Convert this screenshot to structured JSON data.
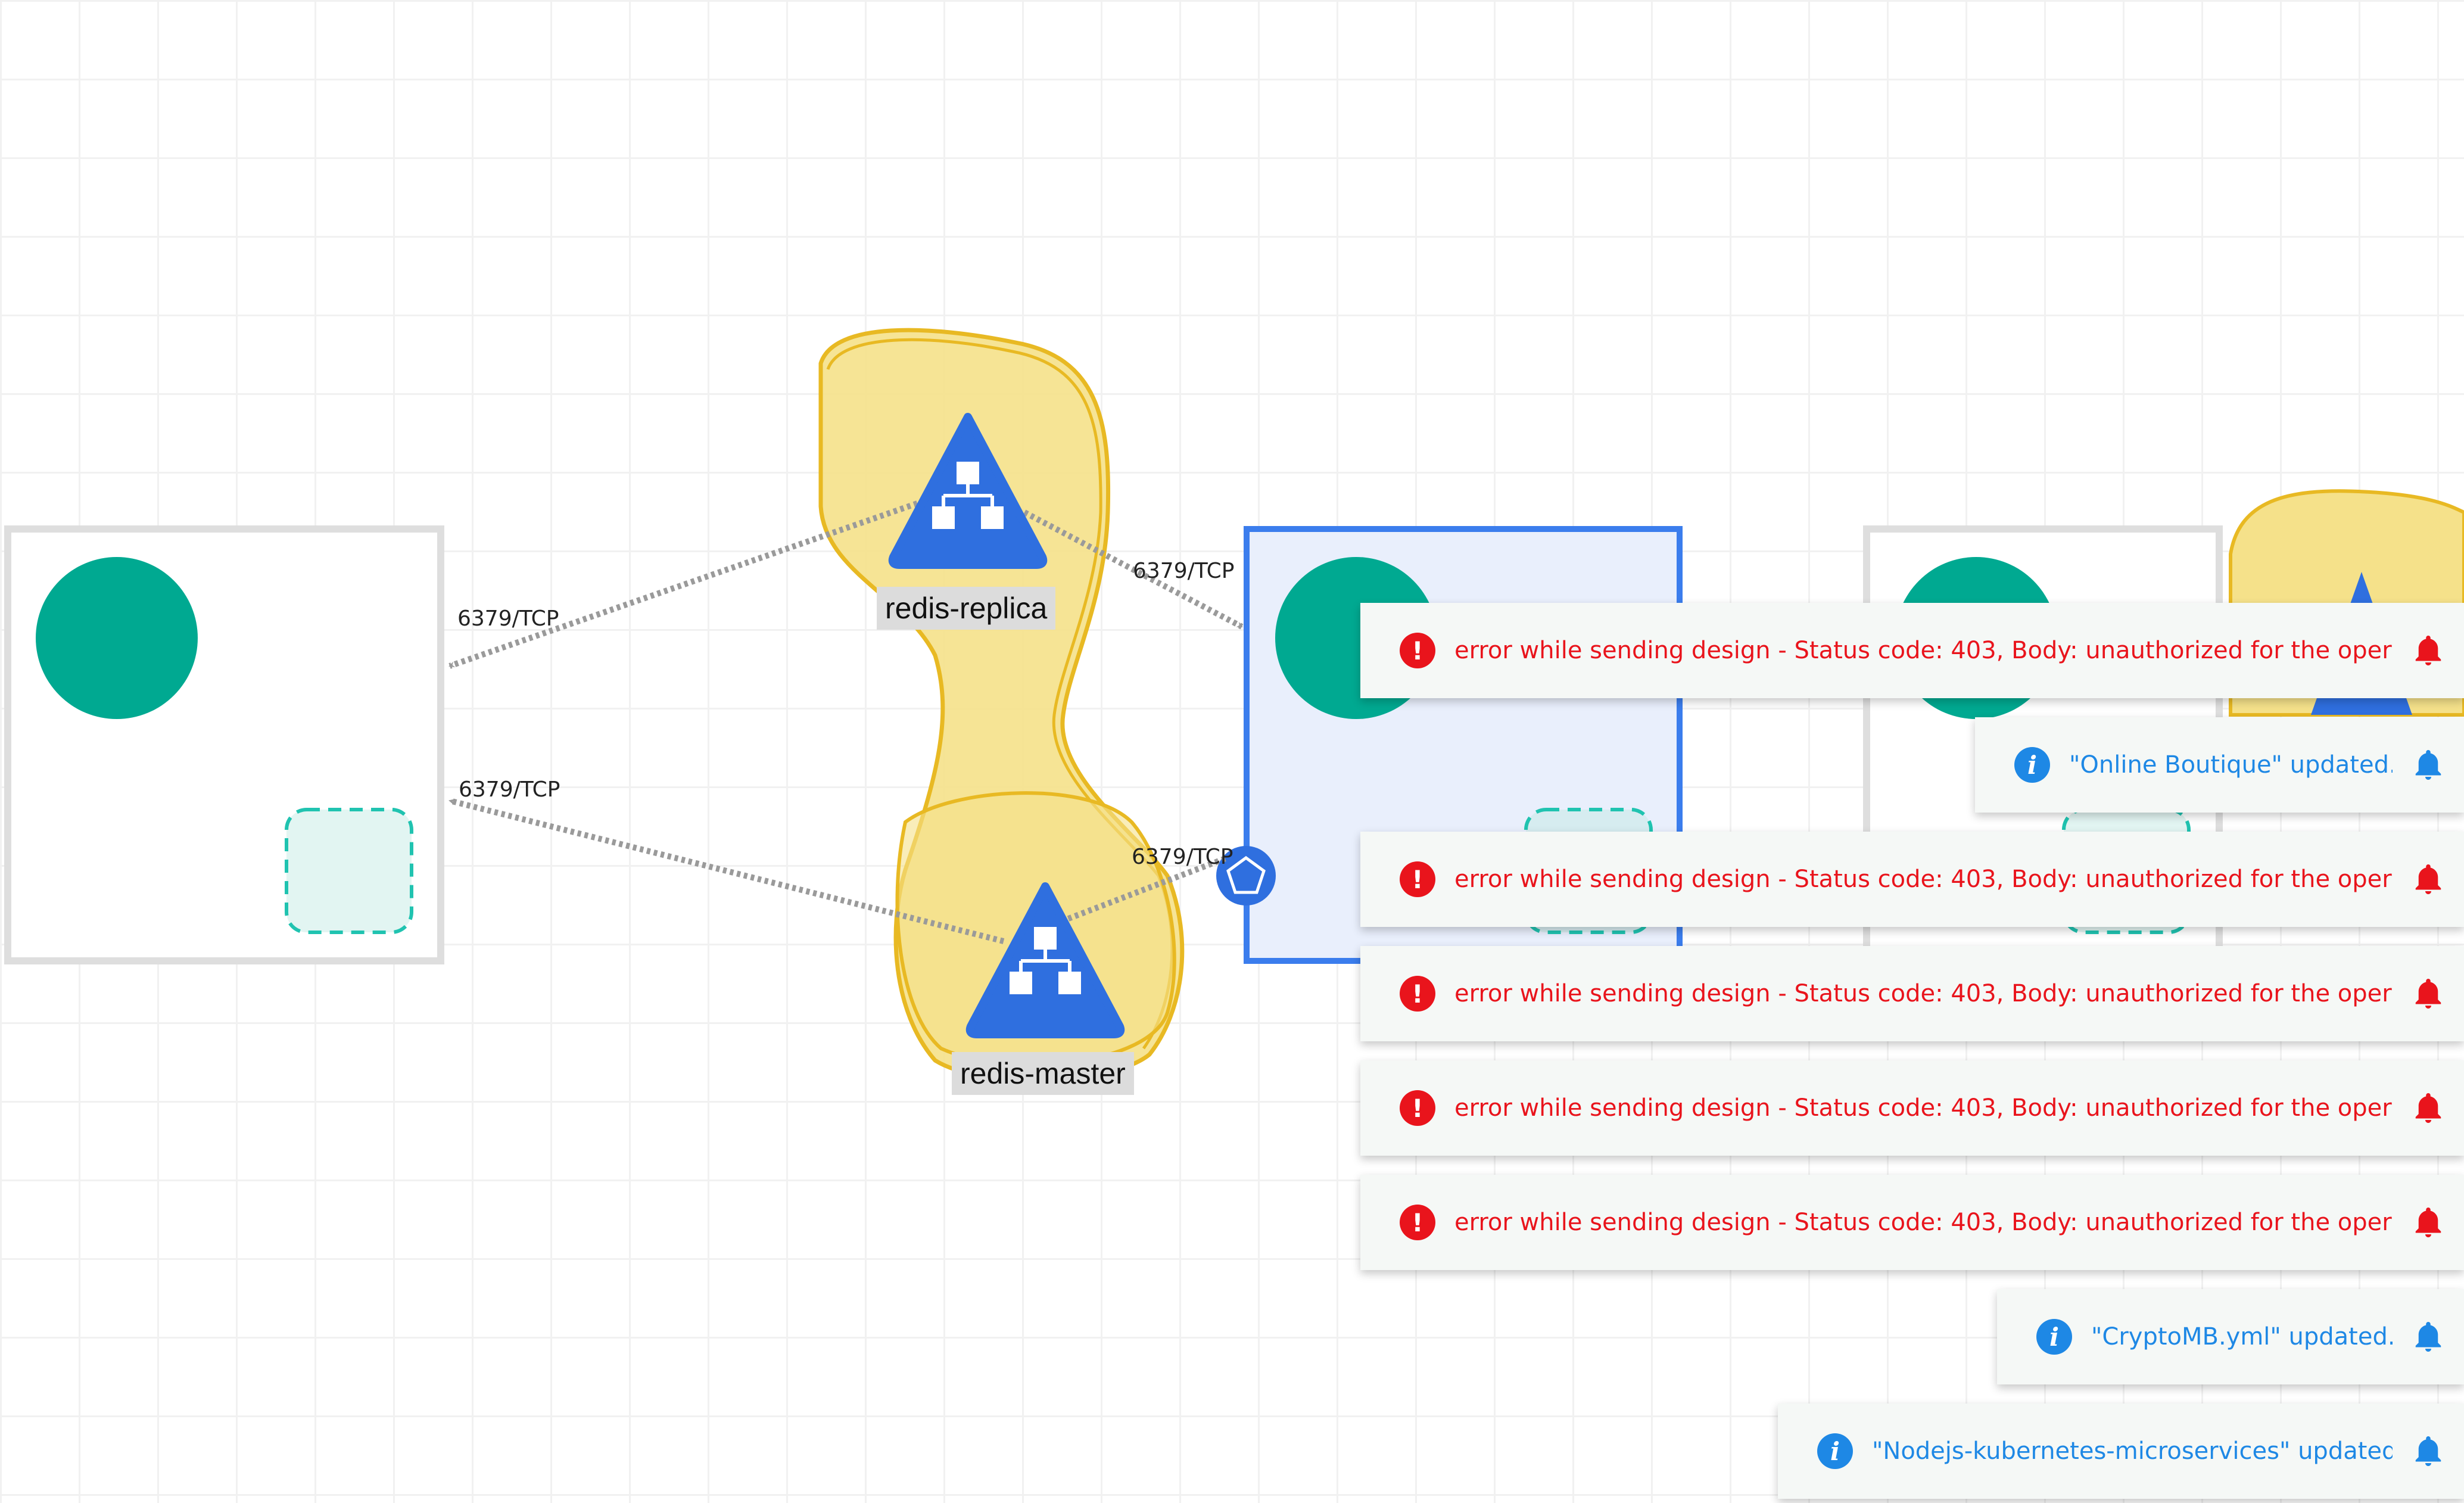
{
  "nodes": {
    "replica": {
      "label": "redis-replica"
    },
    "master": {
      "label": "redis-master"
    }
  },
  "edges": [
    {
      "label": "6379/TCP"
    },
    {
      "label": "6379/TCP"
    },
    {
      "label": "6379/TCP"
    },
    {
      "label": "6379/TCP"
    }
  ],
  "colors": {
    "group_fill": "#f5e18a",
    "group_stroke": "#e8b923",
    "service_blue": "#2f6fdf",
    "pod_teal": "#00a991",
    "selected_border": "#3b7ded",
    "error": "#e9141c",
    "info": "#1e88e5"
  },
  "notifications": [
    {
      "type": "error",
      "icon": "error-icon",
      "message": "error while sending design - Status code: 403, Body: unauthorized for the operation"
    },
    {
      "type": "info",
      "icon": "info-icon",
      "message": "\"Online Boutique\" updated."
    },
    {
      "type": "error",
      "icon": "error-icon",
      "message": "error while sending design - Status code: 403, Body: unauthorized for the operation"
    },
    {
      "type": "error",
      "icon": "error-icon",
      "message": "error while sending design - Status code: 403, Body: unauthorized for the operation"
    },
    {
      "type": "error",
      "icon": "error-icon",
      "message": "error while sending design - Status code: 403, Body: unauthorized for the operation"
    },
    {
      "type": "error",
      "icon": "error-icon",
      "message": "error while sending design - Status code: 403, Body: unauthorized for the operation"
    },
    {
      "type": "info",
      "icon": "info-icon",
      "message": "\"CryptoMB.yml\" updated."
    },
    {
      "type": "info",
      "icon": "info-icon",
      "message": "\"Nodejs-kubernetes-microservices\" updated."
    }
  ]
}
